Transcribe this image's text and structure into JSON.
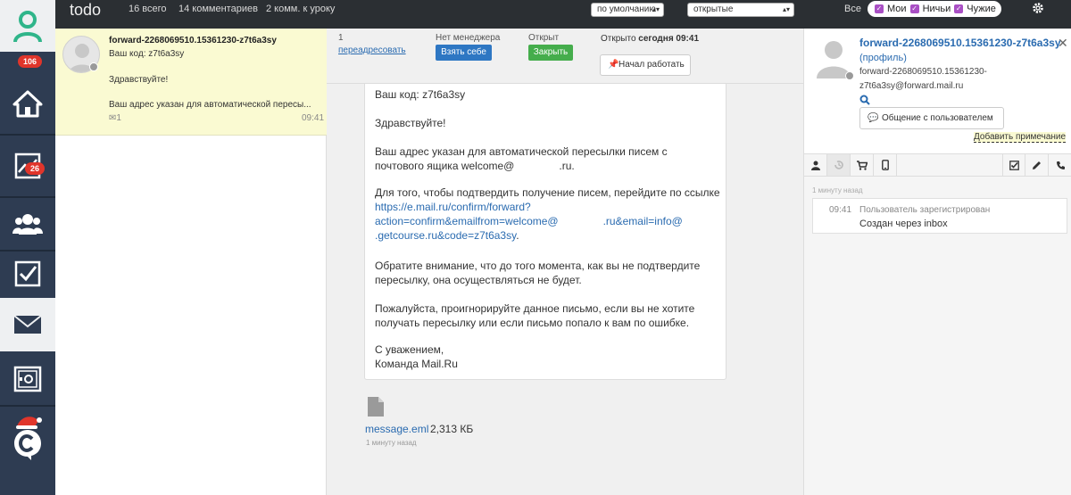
{
  "sidebar": {
    "badges": {
      "inbox": "106",
      "stats": "26"
    }
  },
  "topbar": {
    "title": "todo",
    "total": "16 всего",
    "comments": "14 комментариев",
    "lesson_comments": "2 комм. к уроку",
    "sort_select": "по умолчанию",
    "state_select": "открытые",
    "filter_all": "Все",
    "filters": [
      "Мои",
      "Ничьи",
      "Чужие"
    ]
  },
  "conversation": {
    "name": "forward-2268069510.15361230-z7t6a3sy",
    "code": "Ваш код: z7t6a3sy",
    "greeting": "Здравствуйте!",
    "snippet": "Ваш адрес указан для автоматической пересы...",
    "mail_count": "1",
    "time": "09:41"
  },
  "header": {
    "count": "1",
    "redirect_link": "переадресовать",
    "no_manager": "Нет менеджера",
    "take_button": "Взять себе",
    "opened_label": "Открыт",
    "close_button": "Закрыть",
    "opened_prefix": "Открыто",
    "opened_time": "сегодня 09:41",
    "start_work_button": "Начал работать"
  },
  "message": {
    "code": "Ваш код: z7t6a3sy",
    "greeting": "Здравствуйте!",
    "para1_line1": "Ваш адрес указан для автоматической пересылки писем с",
    "para1_line2": "почтового ящика welcome@               .ru.",
    "para2_line1": "Для того, чтобы подтвердить получение писем, перейдите по ссылке",
    "link_line1": "https://e.mail.ru/confirm/forward?",
    "link_line2": "action=confirm&emailfrom=welcome@               .ru&email=info@",
    "link_line3": ".getcourse.ru&code=z7t6a3sy",
    "link_period": ".",
    "para3_line1": "Обратите внимание, что до того момента, как вы не подтвердите",
    "para3_line2": "пересылку, она осуществляться не будет.",
    "para4_line1": "Пожалуйста, проигнорируйте данное письмо, если вы не хотите",
    "para4_line2": "получать пересылку или если письмо попало к вам по ошибке.",
    "sign_line1": "С уважением,",
    "sign_line2": "Команда Mail.Ru"
  },
  "attachment": {
    "name": "message.eml",
    "size": "2,313 КБ",
    "time": "1 минуту назад"
  },
  "profile": {
    "name": "forward-2268069510.15361230-z7t6a3sy",
    "profile_link": "(профиль)",
    "email_line1": "forward-2268069510.15361230-",
    "email_line2": "z7t6a3sy@forward.mail.ru",
    "chat_button": "Общение с пользователем",
    "add_note": "Добавить примечание"
  },
  "feed": {
    "ago": "1 минуту назад",
    "event_time": "09:41",
    "event_title": "Пользователь зарегистрирован",
    "event_sub": "Создан через inbox"
  },
  "colors": {
    "sidebar": "#2e3c52",
    "topbar": "#2b2f33",
    "highlight": "#fafad2",
    "link": "#2a6bb0",
    "take_button": "#2e77c3",
    "close_button": "#45ad4c",
    "filter_check": "#a94fc4",
    "badge": "#e0352b"
  }
}
